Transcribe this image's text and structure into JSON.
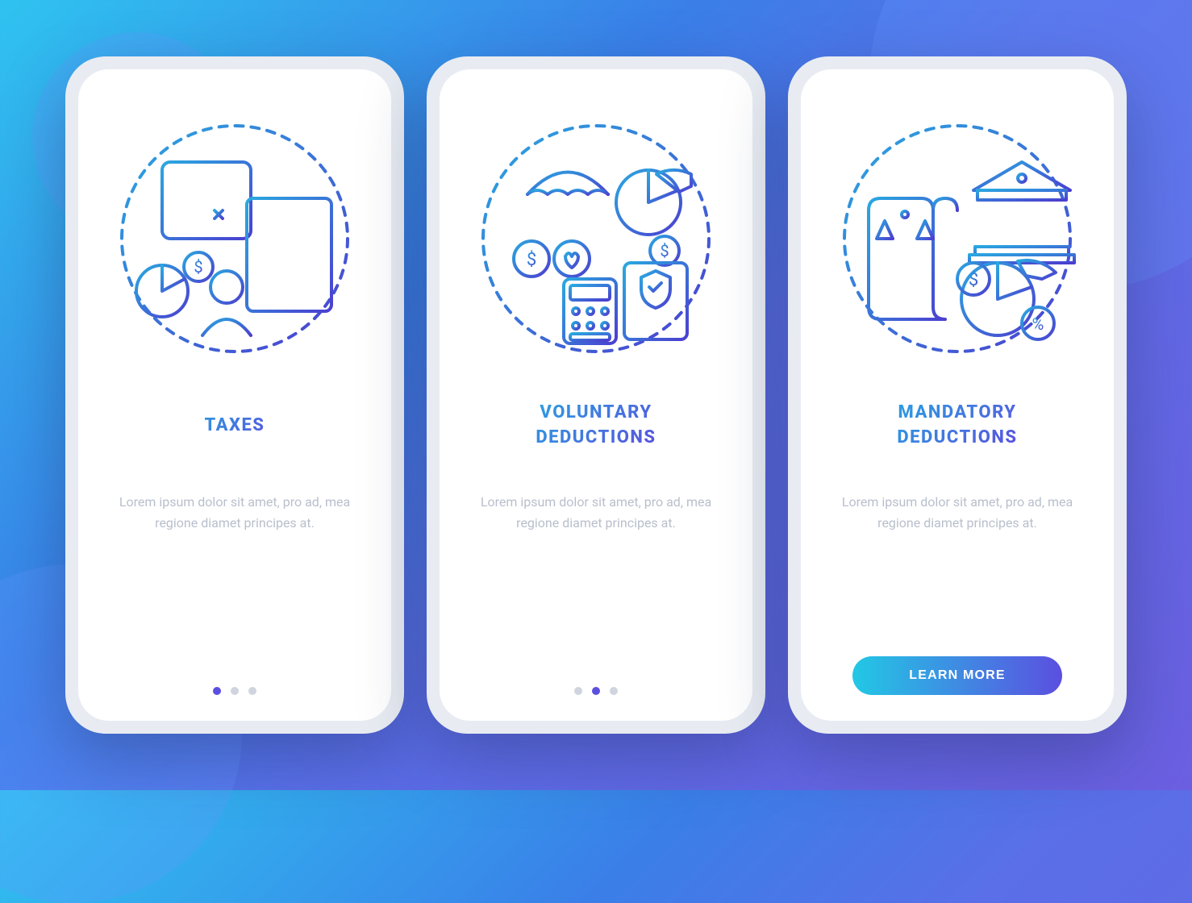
{
  "screens": [
    {
      "title": "TAXES",
      "description": "Lorem ipsum dolor sit amet, pro ad, mea regione diamet principes at.",
      "active_dot": 0,
      "has_button": false
    },
    {
      "title": "VOLUNTARY\nDEDUCTIONS",
      "description": "Lorem ipsum dolor sit amet, pro ad, mea regione diamet principes at.",
      "active_dot": 1,
      "has_button": false
    },
    {
      "title": "MANDATORY\nDEDUCTIONS",
      "description": "Lorem ipsum dolor sit amet, pro ad, mea regione diamet principes at.",
      "active_dot": 2,
      "has_button": true
    }
  ],
  "button_label": "LEARN MORE",
  "dot_count": 3,
  "colors": {
    "gradient_start": "#22C8E5",
    "gradient_end": "#5B4FE0",
    "text_muted": "#B8BFCC"
  }
}
